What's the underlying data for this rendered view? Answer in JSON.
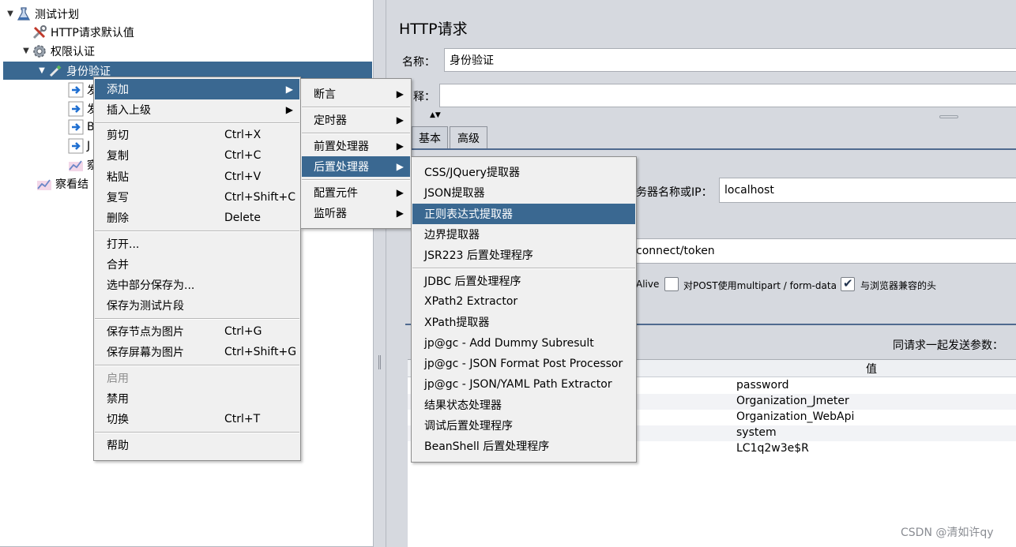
{
  "tree": {
    "items": [
      {
        "label": "测试计划",
        "expanded": true
      },
      {
        "label": "HTTP请求默认值"
      },
      {
        "label": "权限认证",
        "expanded": true
      },
      {
        "label": "身份验证",
        "expanded": true,
        "selected": true
      },
      {
        "label": "察看结"
      }
    ],
    "partial_children": [
      "发",
      "发",
      "B",
      "J",
      "察"
    ]
  },
  "right": {
    "title": "HTTP请求",
    "name_label": "名称：",
    "name_value": "身份验证",
    "comment_label": "释：",
    "tabs": [
      "基本",
      "高级"
    ],
    "server_label": "务器名称或IP：",
    "server_value": "localhost",
    "path_value": "connect/token",
    "keepalive_label": "Alive",
    "multipart_label": "对POST使用multipart / form-data",
    "browser_label": "与浏览器兼容的头",
    "send_params_label": "同请求一起发送参数：",
    "value_header": "值",
    "values": [
      "password",
      "Organization_Jmeter",
      "Organization_WebApi",
      "system",
      "LC1q2w3e$R"
    ]
  },
  "menu_main": {
    "items": [
      {
        "label": "添加",
        "submenu": true,
        "highlighted": true
      },
      {
        "label": "插入上级",
        "submenu": true
      },
      {
        "label": "剪切",
        "shortcut": "Ctrl+X"
      },
      {
        "label": "复制",
        "shortcut": "Ctrl+C"
      },
      {
        "label": "粘贴",
        "shortcut": "Ctrl+V"
      },
      {
        "label": "复写",
        "shortcut": "Ctrl+Shift+C"
      },
      {
        "label": "删除",
        "shortcut": "Delete"
      },
      {
        "label": "打开..."
      },
      {
        "label": "合并"
      },
      {
        "label": "选中部分保存为..."
      },
      {
        "label": "保存为测试片段"
      },
      {
        "label": "保存节点为图片",
        "shortcut": "Ctrl+G"
      },
      {
        "label": "保存屏幕为图片",
        "shortcut": "Ctrl+Shift+G"
      },
      {
        "label": "启用",
        "disabled": true
      },
      {
        "label": "禁用"
      },
      {
        "label": "切换",
        "shortcut": "Ctrl+T"
      },
      {
        "label": "帮助"
      }
    ]
  },
  "menu_add": {
    "items": [
      {
        "label": "断言"
      },
      {
        "label": "定时器"
      },
      {
        "label": "前置处理器"
      },
      {
        "label": "后置处理器",
        "highlighted": true
      },
      {
        "label": "配置元件"
      },
      {
        "label": "监听器"
      }
    ]
  },
  "menu_post": {
    "items": [
      {
        "label": "CSS/JQuery提取器"
      },
      {
        "label": "JSON提取器"
      },
      {
        "label": "正则表达式提取器",
        "highlighted": true
      },
      {
        "label": "边界提取器"
      },
      {
        "label": "JSR223 后置处理程序"
      },
      {
        "label": "JDBC 后置处理程序"
      },
      {
        "label": "XPath2 Extractor"
      },
      {
        "label": "XPath提取器"
      },
      {
        "label": "jp@gc - Add Dummy Subresult"
      },
      {
        "label": "jp@gc - JSON Format Post Processor"
      },
      {
        "label": "jp@gc - JSON/YAML Path Extractor"
      },
      {
        "label": "结果状态处理器"
      },
      {
        "label": "调试后置处理程序"
      },
      {
        "label": "BeanShell 后置处理程序"
      }
    ]
  },
  "arrow_glyph": "▶",
  "watermark": "CSDN @清如许qy",
  "colors": {
    "selection": "#3a6891",
    "panel": "#d6d9df",
    "divider": "#4f6a8f"
  }
}
